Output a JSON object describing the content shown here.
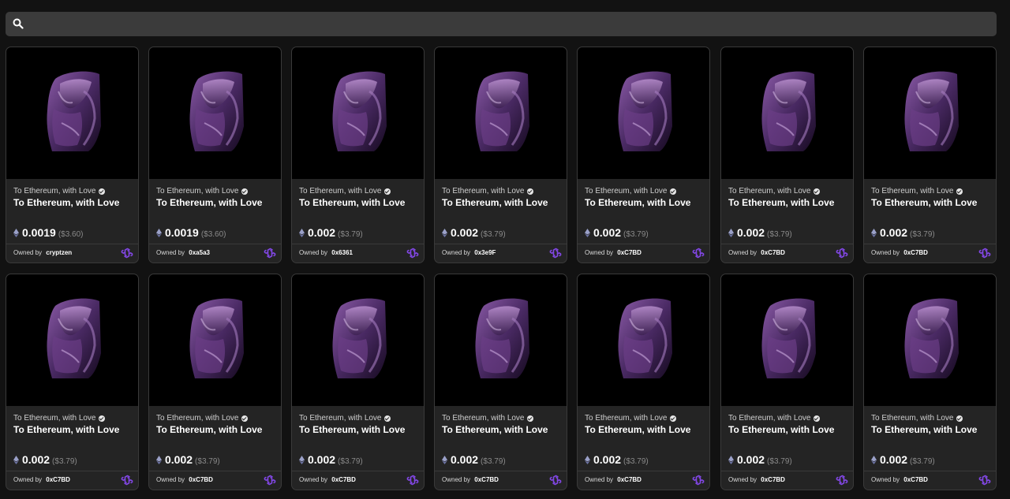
{
  "search": {
    "placeholder": "",
    "value": ""
  },
  "colors": {
    "background": "#121212",
    "card": "#242424",
    "accent_polygon": "#8247e5"
  },
  "owned_by_label": "Owned by",
  "cards": [
    {
      "collection": "To Ethereum, with Love",
      "title": "To Ethereum, with Love",
      "price_eth": "0.0019",
      "price_usd": "($3.60)",
      "owner": "cryptzen",
      "chain_icon": "polygon-icon"
    },
    {
      "collection": "To Ethereum, with Love",
      "title": "To Ethereum, with Love",
      "price_eth": "0.0019",
      "price_usd": "($3.60)",
      "owner": "0xa5a3",
      "chain_icon": "polygon-icon"
    },
    {
      "collection": "To Ethereum, with Love",
      "title": "To Ethereum, with Love",
      "price_eth": "0.002",
      "price_usd": "($3.79)",
      "owner": "0x6361",
      "chain_icon": "polygon-icon"
    },
    {
      "collection": "To Ethereum, with Love",
      "title": "To Ethereum, with Love",
      "price_eth": "0.002",
      "price_usd": "($3.79)",
      "owner": "0x3e9F",
      "chain_icon": "polygon-icon"
    },
    {
      "collection": "To Ethereum, with Love",
      "title": "To Ethereum, with Love",
      "price_eth": "0.002",
      "price_usd": "($3.79)",
      "owner": "0xC7BD",
      "chain_icon": "polygon-icon"
    },
    {
      "collection": "To Ethereum, with Love",
      "title": "To Ethereum, with Love",
      "price_eth": "0.002",
      "price_usd": "($3.79)",
      "owner": "0xC7BD",
      "chain_icon": "polygon-icon"
    },
    {
      "collection": "To Ethereum, with Love",
      "title": "To Ethereum, with Love",
      "price_eth": "0.002",
      "price_usd": "($3.79)",
      "owner": "0xC7BD",
      "chain_icon": "polygon-icon"
    },
    {
      "collection": "To Ethereum, with Love",
      "title": "To Ethereum, with Love",
      "price_eth": "0.002",
      "price_usd": "($3.79)",
      "owner": "0xC7BD",
      "chain_icon": "polygon-icon"
    },
    {
      "collection": "To Ethereum, with Love",
      "title": "To Ethereum, with Love",
      "price_eth": "0.002",
      "price_usd": "($3.79)",
      "owner": "0xC7BD",
      "chain_icon": "polygon-icon"
    },
    {
      "collection": "To Ethereum, with Love",
      "title": "To Ethereum, with Love",
      "price_eth": "0.002",
      "price_usd": "($3.79)",
      "owner": "0xC7BD",
      "chain_icon": "polygon-icon"
    },
    {
      "collection": "To Ethereum, with Love",
      "title": "To Ethereum, with Love",
      "price_eth": "0.002",
      "price_usd": "($3.79)",
      "owner": "0xC7BD",
      "chain_icon": "polygon-icon"
    },
    {
      "collection": "To Ethereum, with Love",
      "title": "To Ethereum, with Love",
      "price_eth": "0.002",
      "price_usd": "($3.79)",
      "owner": "0xC7BD",
      "chain_icon": "polygon-icon"
    },
    {
      "collection": "To Ethereum, with Love",
      "title": "To Ethereum, with Love",
      "price_eth": "0.002",
      "price_usd": "($3.79)",
      "owner": "0xC7BD",
      "chain_icon": "polygon-icon"
    },
    {
      "collection": "To Ethereum, with Love",
      "title": "To Ethereum, with Love",
      "price_eth": "0.002",
      "price_usd": "($3.79)",
      "owner": "0xC7BD",
      "chain_icon": "polygon-icon"
    }
  ]
}
